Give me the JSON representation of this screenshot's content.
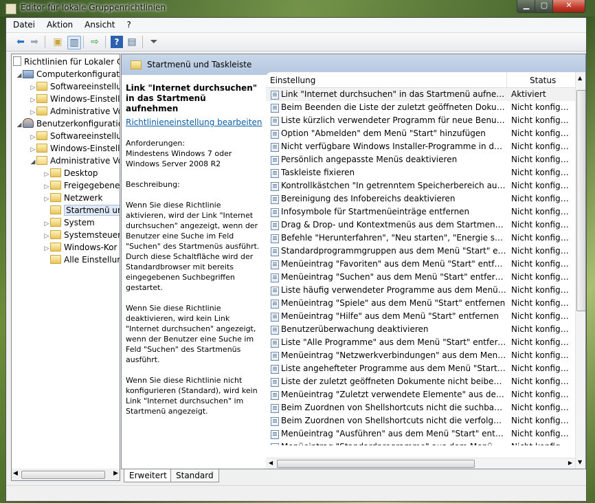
{
  "window": {
    "title": "Editor für lokale Gruppenrichtlinien"
  },
  "menu": [
    "Datei",
    "Aktion",
    "Ansicht",
    "?"
  ],
  "toolbar": {
    "buttons": [
      "back-arrow-icon",
      "forward-arrow-icon",
      "up-folder-icon",
      "show-tree-icon",
      "export-list-icon",
      "help-icon",
      "properties-icon",
      "filter-icon"
    ]
  },
  "tree": [
    {
      "label": "Richtlinien für Lokaler Co",
      "icon": "doc",
      "arrow": ""
    },
    {
      "label": "Computerkonfigurati",
      "icon": "pc",
      "arrow": "◢"
    },
    {
      "label": "Softwareeinstellu",
      "icon": "folder",
      "arrow": "▷"
    },
    {
      "label": "Windows-Einstell",
      "icon": "folder",
      "arrow": "▷"
    },
    {
      "label": "Administrative Vo",
      "icon": "folder",
      "arrow": "▷"
    },
    {
      "label": "Benutzerkonfiguratio",
      "icon": "user",
      "arrow": "◢"
    },
    {
      "label": "Softwareeinstellu",
      "icon": "folder",
      "arrow": "▷"
    },
    {
      "label": "Windows-Einstell",
      "icon": "folder",
      "arrow": "▷"
    },
    {
      "label": "Administrative Vo",
      "icon": "folder",
      "arrow": "◢"
    },
    {
      "label": "Desktop",
      "icon": "folder",
      "arrow": "▷"
    },
    {
      "label": "Freigegebene",
      "icon": "folder",
      "arrow": "▷"
    },
    {
      "label": "Netzwerk",
      "icon": "folder",
      "arrow": "▷"
    },
    {
      "label": "Startmenü un",
      "icon": "folder",
      "arrow": ""
    },
    {
      "label": "System",
      "icon": "folder",
      "arrow": "▷"
    },
    {
      "label": "Systemsteuer",
      "icon": "folder",
      "arrow": "▷"
    },
    {
      "label": "Windows-Kor",
      "icon": "folder",
      "arrow": "▷"
    },
    {
      "label": "Alle Einstellur",
      "icon": "folder",
      "arrow": ""
    }
  ],
  "header": {
    "title": "Startmenü und Taskleiste"
  },
  "description": {
    "policy_name": "Link \"Internet durchsuchen\" in das Startmenü aufnehmen",
    "edit_link": "Richtlinieneinstellung bearbeiten",
    "requirements": "Anforderungen:\nMindestens Windows 7 oder Windows Server 2008 R2",
    "description_label": "Beschreibung:",
    "para1": "Wenn Sie diese Richtlinie aktivieren, wird der Link \"Internet durchsuchen\" angezeigt, wenn der Benutzer eine Suche im Feld \"Suchen\" des Startmenüs ausführt. Durch diese Schaltfläche wird der Standardbrowser mit bereits eingegebenen Suchbegriffen gestartet.",
    "para2": "Wenn Sie diese Richtlinie deaktivieren, wird kein Link \"Internet durchsuchen\" angezeigt, wenn der Benutzer eine Suche im Feld \"Suchen\" des Startmenüs ausführt.",
    "para3": "Wenn Sie diese Richtlinie nicht konfigurieren (Standard), wird kein Link \"Internet durchsuchen\" im Startmenü angezeigt."
  },
  "columns": {
    "setting": "Einstellung",
    "status": "Status"
  },
  "rows": [
    {
      "name": "Link \"Internet durchsuchen\" in das Startmenü aufnehmen",
      "status": "Aktiviert"
    },
    {
      "name": "Beim Beenden die Liste der zuletzt geöffneten Dokumente le...",
      "status": "Nicht konfigur..."
    },
    {
      "name": "Liste kürzlich verwendeter Programm für neue Benutzer lösc...",
      "status": "Nicht konfigur..."
    },
    {
      "name": "Option \"Abmelden\" dem Menü \"Start\" hinzufügen",
      "status": "Nicht konfigur..."
    },
    {
      "name": "Nicht verfügbare Windows Installer-Programme in den Verk...",
      "status": "Nicht konfigur..."
    },
    {
      "name": "Persönlich angepasste Menüs deaktivieren",
      "status": "Nicht konfigur..."
    },
    {
      "name": "Taskleiste fixieren",
      "status": "Nicht konfigur..."
    },
    {
      "name": "Kontrollkästchen \"In getrenntem Speicherbereich ausführen...",
      "status": "Nicht konfigur..."
    },
    {
      "name": "Bereinigung des Infobereichs deaktivieren",
      "status": "Nicht konfigur..."
    },
    {
      "name": "Infosymbole für Startmenüeinträge entfernen",
      "status": "Nicht konfigur..."
    },
    {
      "name": "Drag & Drop- und Kontextmenüs aus dem Startmenü entfe...",
      "status": "Nicht konfigur..."
    },
    {
      "name": "Befehle \"Herunterfahren\", \"Neu starten\", \"Energie sparen\" u...",
      "status": "Nicht konfigur..."
    },
    {
      "name": "Standardprogrammgruppen aus dem Menü \"Start\" entfernen",
      "status": "Nicht konfigur..."
    },
    {
      "name": "Menüeintrag \"Favoriten\" aus dem Menü \"Start\" entfernen",
      "status": "Nicht konfigur..."
    },
    {
      "name": "Menüeintrag \"Suchen\" aus dem Menü \"Start\" entfernen",
      "status": "Nicht konfigur..."
    },
    {
      "name": "Liste häufig verwendeter Programme aus dem Menü \"Start\" ...",
      "status": "Nicht konfigur..."
    },
    {
      "name": "Menüeintrag \"Spiele\" aus dem Menü \"Start\" entfernen",
      "status": "Nicht konfigur..."
    },
    {
      "name": "Menüeintrag \"Hilfe\" aus dem Menü \"Start\" entfernen",
      "status": "Nicht konfigur..."
    },
    {
      "name": "Benutzerüberwachung deaktivieren",
      "status": "Nicht konfigur..."
    },
    {
      "name": "Liste \"Alle Programme\" aus dem Menü \"Start\" entfernen",
      "status": "Nicht konfigur..."
    },
    {
      "name": "Menüeintrag \"Netzwerkverbindungen\" aus dem Menü \"Star...",
      "status": "Nicht konfigur..."
    },
    {
      "name": "Liste angehefteter Programme aus dem Menü \"Start\" entfer...",
      "status": "Nicht konfigur..."
    },
    {
      "name": "Liste der zuletzt geöffneten Dokumente nicht beibehalten",
      "status": "Nicht konfigur..."
    },
    {
      "name": "Menüeintrag \"Zuletzt verwendete Elemente\" aus dem Menü...",
      "status": "Nicht konfigur..."
    },
    {
      "name": "Beim Zuordnen von Shellshortcuts nicht die suchbasierte M...",
      "status": "Nicht konfigur..."
    },
    {
      "name": "Beim Zuordnen von Shellshortcuts nicht die verfolgungsbas...",
      "status": "Nicht konfigur..."
    },
    {
      "name": "Menüeintrag \"Ausführen\" aus dem Menü \"Start\" entfernen",
      "status": "Nicht konfigur..."
    },
    {
      "name": "Menüeintrag \"Standardprogramme\" aus dem Menü \"Start\"",
      "status": "Nicht konfigur..."
    }
  ],
  "tabs": [
    "Erweitert",
    "Standard"
  ]
}
